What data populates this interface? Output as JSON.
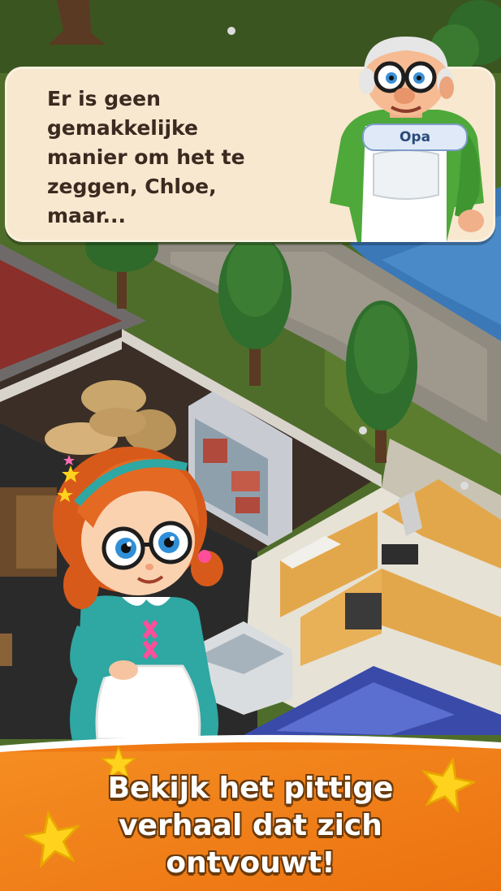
{
  "dialog": {
    "text": "Er is geen\ngemakkelijke\nmanier om het te\nzeggen, Chloe,\nmaar...",
    "speaker_name": "Opa"
  },
  "banner": {
    "caption": "Bekijk het pittige\nverhaal dat zich\nontvouwt!"
  },
  "colors": {
    "dialog_bg": "#f7e8cf",
    "dialog_text": "#3a2a20",
    "speaker_tag_bg": "#dfe9f8",
    "banner_orange": "#f07a14",
    "star_yellow": "#ffd21e",
    "grass": "#4f6d2a"
  },
  "icons": [
    "star-icon"
  ]
}
